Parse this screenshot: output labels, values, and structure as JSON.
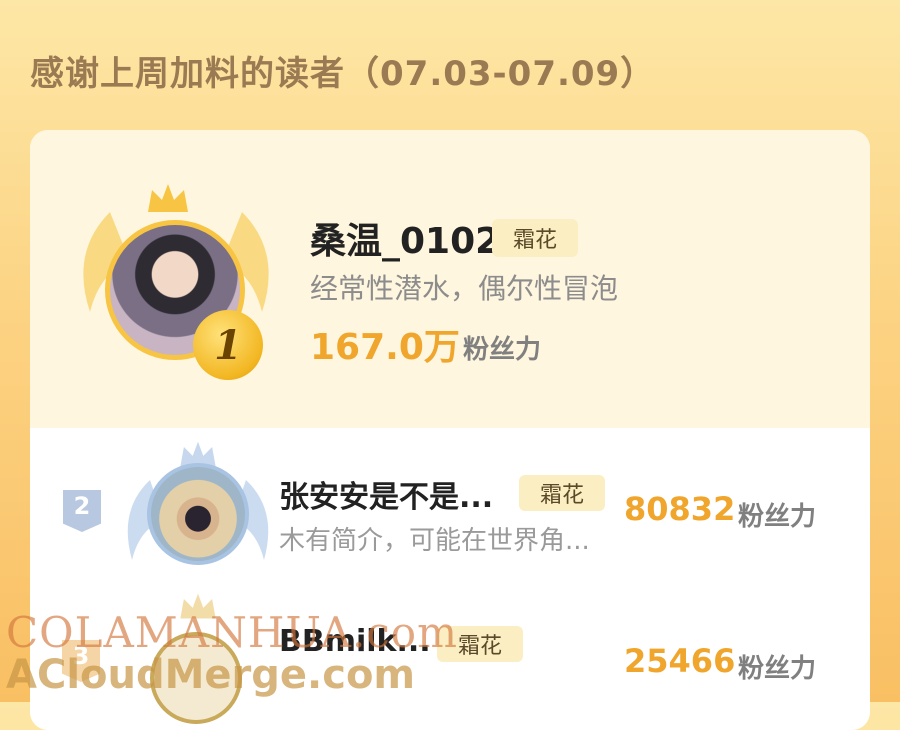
{
  "header": {
    "title": "感谢上周加料的读者（07.03-07.09）"
  },
  "ranking": [
    {
      "rank": "1",
      "name": "桑温_0102",
      "badge": "霜花",
      "bio": "经常性潜水，偶尔性冒泡",
      "fans": "167.0万",
      "fans_label": "粉丝力"
    },
    {
      "rank": "2",
      "name": "张安安是不是...",
      "badge": "霜花",
      "bio": "木有简介，可能在世界角...",
      "fans": "80832",
      "fans_label": "粉丝力"
    },
    {
      "rank": "3",
      "name": "BBmilk...",
      "badge": "霜花",
      "fans": "25466",
      "fans_label": "粉丝力"
    }
  ],
  "watermark": {
    "line1": "COLAMANHUA.com",
    "line2": "ACloudMerge.com"
  },
  "colors": {
    "accent": "#f0a52c",
    "gold": "#f7c443",
    "silver": "#a9c3e3"
  }
}
